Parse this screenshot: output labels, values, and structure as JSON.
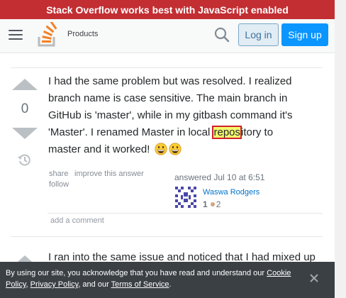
{
  "banner": {
    "text": "Stack Overflow works best with JavaScript enabled"
  },
  "topbar": {
    "menu_icon": "hamburger-menu-icon",
    "logo_icon": "stack-overflow-logo",
    "products_label": "Products",
    "search_icon": "search-icon",
    "login_label": "Log in",
    "signup_label": "Sign up"
  },
  "answer": {
    "vote_count": "0",
    "body_before": "I had the same problem but was resolved. I realized branch name is case sensitive. The main branch in GitHub is 'master', while in my gitbash command it's 'Master'. I renamed Master in local ",
    "body_highlight": "repos",
    "body_after": "itory to master and it worked!",
    "emojis": [
      "grinning-face",
      "grinning-face"
    ],
    "actions": {
      "share": "share",
      "improve": "improve this answer",
      "follow": "follow"
    },
    "answered_text": "answered Jul 10 at 6:51",
    "user": {
      "name": "Waswa Rodgers",
      "reputation": "1",
      "bronze_badges": "2"
    },
    "add_comment": "add a comment"
  },
  "next_answer": {
    "body_start": "I ran into the same issue and noticed that I had mixed up"
  },
  "cookie_notice": {
    "text_1": "By using our site, you acknowledge that you have read and understand our ",
    "link_cookie": "Cookie Policy",
    "sep_1": ", ",
    "link_privacy": "Privacy Policy",
    "text_2": ", and our ",
    "link_terms": "Terms of Service",
    "text_3": ".",
    "close_icon": "close-icon"
  },
  "colors": {
    "banner_bg": "#c22e32",
    "primary_button": "#0a95ff",
    "highlight": "#f3f76d",
    "highlight_border": "#d0212c",
    "link": "#0074cc"
  }
}
